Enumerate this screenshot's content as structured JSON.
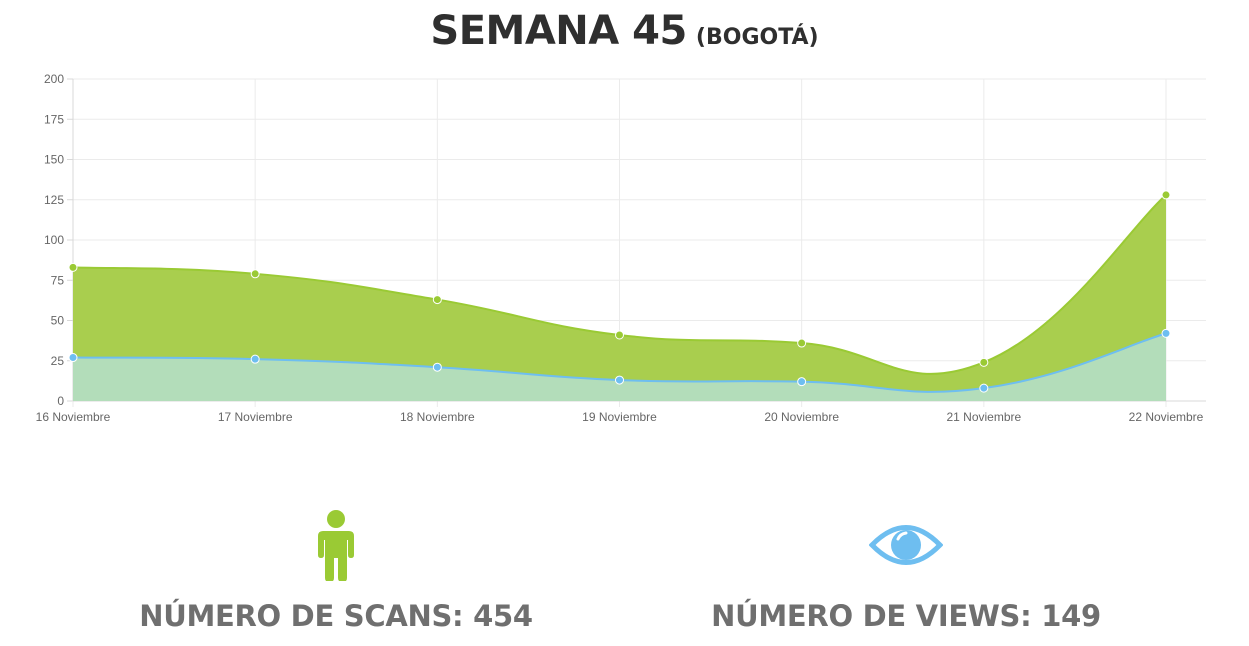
{
  "title": {
    "main": "SEMANA 45",
    "sub": "(BOGOTÁ)"
  },
  "colors": {
    "scans": "#9ACA34",
    "views": "#6EBEF0",
    "views_fill": "#B3DDBA",
    "scans_fill": "#A9CE4E"
  },
  "chart_data": {
    "type": "area",
    "categories": [
      "16 Noviembre",
      "17 Noviembre",
      "18 Noviembre",
      "19 Noviembre",
      "20 Noviembre",
      "21 Noviembre",
      "22 Noviembre"
    ],
    "series": [
      {
        "values": [
          83,
          79,
          63,
          41,
          36,
          24,
          128
        ],
        "color": "#9ACA34"
      },
      {
        "values": [
          27,
          26,
          21,
          13,
          12,
          8,
          42
        ],
        "color": "#6EBEF0"
      }
    ],
    "ylim": [
      0,
      200
    ],
    "yticks": [
      "0",
      "25",
      "50",
      "75",
      "100",
      "125",
      "150",
      "175",
      "200"
    ],
    "grid": true,
    "title": "",
    "xlabel": "",
    "ylabel": ""
  },
  "stats": {
    "scans": {
      "label": "NÚMERO DE SCANS: 454",
      "icon": "person-icon"
    },
    "views": {
      "label": "NÚMERO DE VIEWS: 149",
      "icon": "eye-icon"
    }
  }
}
